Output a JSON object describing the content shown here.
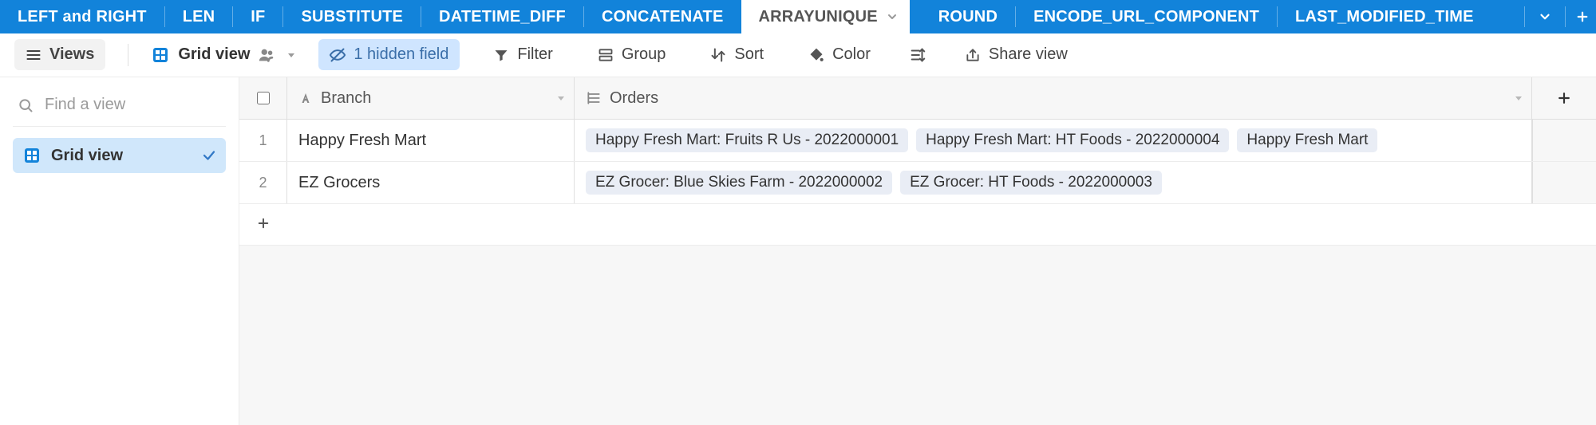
{
  "tabs": {
    "items": [
      "LEFT and RIGHT",
      "LEN",
      "IF",
      "SUBSTITUTE",
      "DATETIME_DIFF",
      "CONCATENATE",
      "ARRAYUNIQUE",
      "ROUND",
      "ENCODE_URL_COMPONENT",
      "LAST_MODIFIED_TIME"
    ],
    "active_index": 6
  },
  "toolbar": {
    "views_label": "Views",
    "gridview_label": "Grid view",
    "hidden_field_label": "1 hidden field",
    "filter_label": "Filter",
    "group_label": "Group",
    "sort_label": "Sort",
    "color_label": "Color",
    "share_label": "Share view"
  },
  "sidebar": {
    "search_placeholder": "Find a view",
    "views": [
      {
        "label": "Grid view",
        "active": true
      }
    ]
  },
  "grid": {
    "columns": {
      "branch": "Branch",
      "orders": "Orders"
    },
    "rows": [
      {
        "num": "1",
        "branch": "Happy Fresh Mart",
        "orders": [
          "Happy Fresh Mart: Fruits R Us - 2022000001",
          "Happy Fresh Mart: HT Foods - 2022000004",
          "Happy Fresh Mart"
        ]
      },
      {
        "num": "2",
        "branch": "EZ Grocers",
        "orders": [
          "EZ Grocer: Blue Skies Farm - 2022000002",
          "EZ Grocer: HT Foods - 2022000003"
        ]
      }
    ]
  }
}
